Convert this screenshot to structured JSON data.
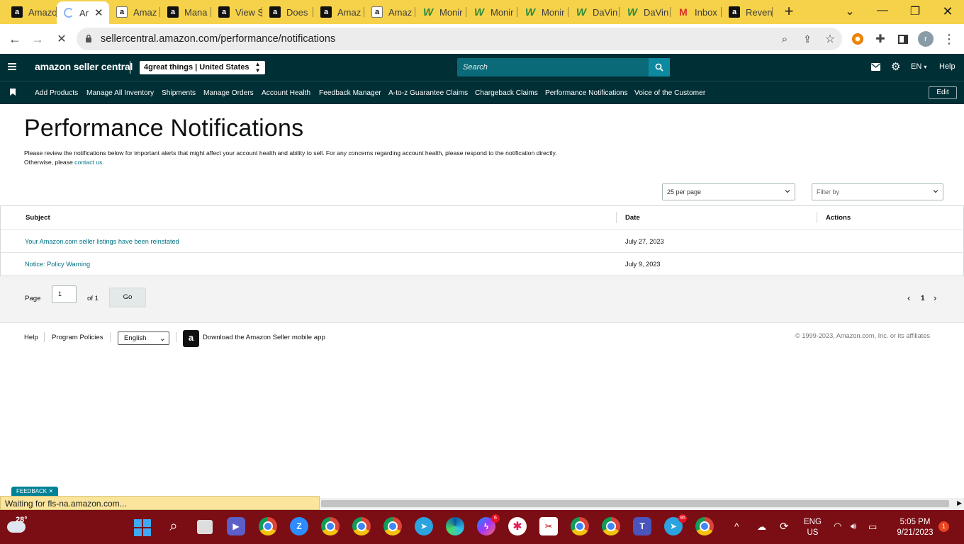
{
  "browser": {
    "tabs": [
      {
        "title": "Amazo",
        "icon": "amazon-favicon"
      },
      {
        "title": "Ar",
        "icon": "loading-spinner",
        "active": true
      },
      {
        "title": "Amaz",
        "icon": "amazon-favicon"
      },
      {
        "title": "Mana",
        "icon": "amazon-favicon"
      },
      {
        "title": "View S",
        "icon": "amazon-favicon"
      },
      {
        "title": "Does",
        "icon": "amazon-favicon"
      },
      {
        "title": "Amaz",
        "icon": "amazon-favicon"
      },
      {
        "title": "Amaz",
        "icon": "amazon-favicon"
      },
      {
        "title": "Monir",
        "icon": "workdiary-favicon"
      },
      {
        "title": "Monir",
        "icon": "workdiary-favicon"
      },
      {
        "title": "Monir",
        "icon": "workdiary-favicon"
      },
      {
        "title": "DaVin",
        "icon": "workdiary-favicon"
      },
      {
        "title": "DaVin",
        "icon": "workdiary-favicon"
      },
      {
        "title": "Inbox",
        "icon": "gmail-favicon"
      },
      {
        "title": "Reven",
        "icon": "amazon-favicon"
      }
    ],
    "url": "sellercentral.amazon.com/performance/notifications",
    "profile_initial": "r",
    "status_text": "Waiting for fls-na.amazon.com..."
  },
  "header": {
    "logo": "amazon seller central",
    "store_selector": "4great things | United States",
    "search_placeholder": "Search",
    "language": "EN",
    "help": "Help"
  },
  "nav": {
    "items": [
      "Add Products",
      "Manage All Inventory",
      "Shipments",
      "Manage Orders",
      "Account Health",
      "Feedback Manager",
      "A-to-z Guarantee Claims",
      "Chargeback Claims",
      "Performance Notifications",
      "Voice of the Customer"
    ],
    "edit_label": "Edit"
  },
  "page": {
    "title": "Performance Notifications",
    "description_line1": "Please review the notifications below for important alerts that might affect your account health and ability to sell. For any concerns regarding account health, please respond to the notification directly.",
    "description_line2_prefix": "Otherwise, please ",
    "contact_link": "contact us.",
    "per_page": "25 per page",
    "filter_placeholder": "Filter by"
  },
  "table": {
    "headers": {
      "subject": "Subject",
      "date": "Date",
      "actions": "Actions"
    },
    "rows": [
      {
        "subject": "Your Amazon.com seller listings have been reinstated",
        "date": "July 27, 2023"
      },
      {
        "subject": "Notice: Policy Warning",
        "date": "July 9, 2023"
      }
    ]
  },
  "pagination": {
    "page_label": "Page",
    "page_value": "1",
    "of_label": "of 1",
    "go_label": "Go",
    "current_page": "1"
  },
  "footer": {
    "help": "Help",
    "policies": "Program Policies",
    "language": "English",
    "app_text": "Download the Amazon Seller mobile app",
    "copyright": "© 1999-2023, Amazon.com, Inc. or its affiliates"
  },
  "feedback_tab": "FEEDBACK",
  "taskbar": {
    "temperature": "28°",
    "lang_line1": "ENG",
    "lang_line2": "US",
    "time": "5:05 PM",
    "date": "9/21/2023",
    "notification_count": "1",
    "messenger_badge": "6",
    "telegram_badge": "95"
  }
}
